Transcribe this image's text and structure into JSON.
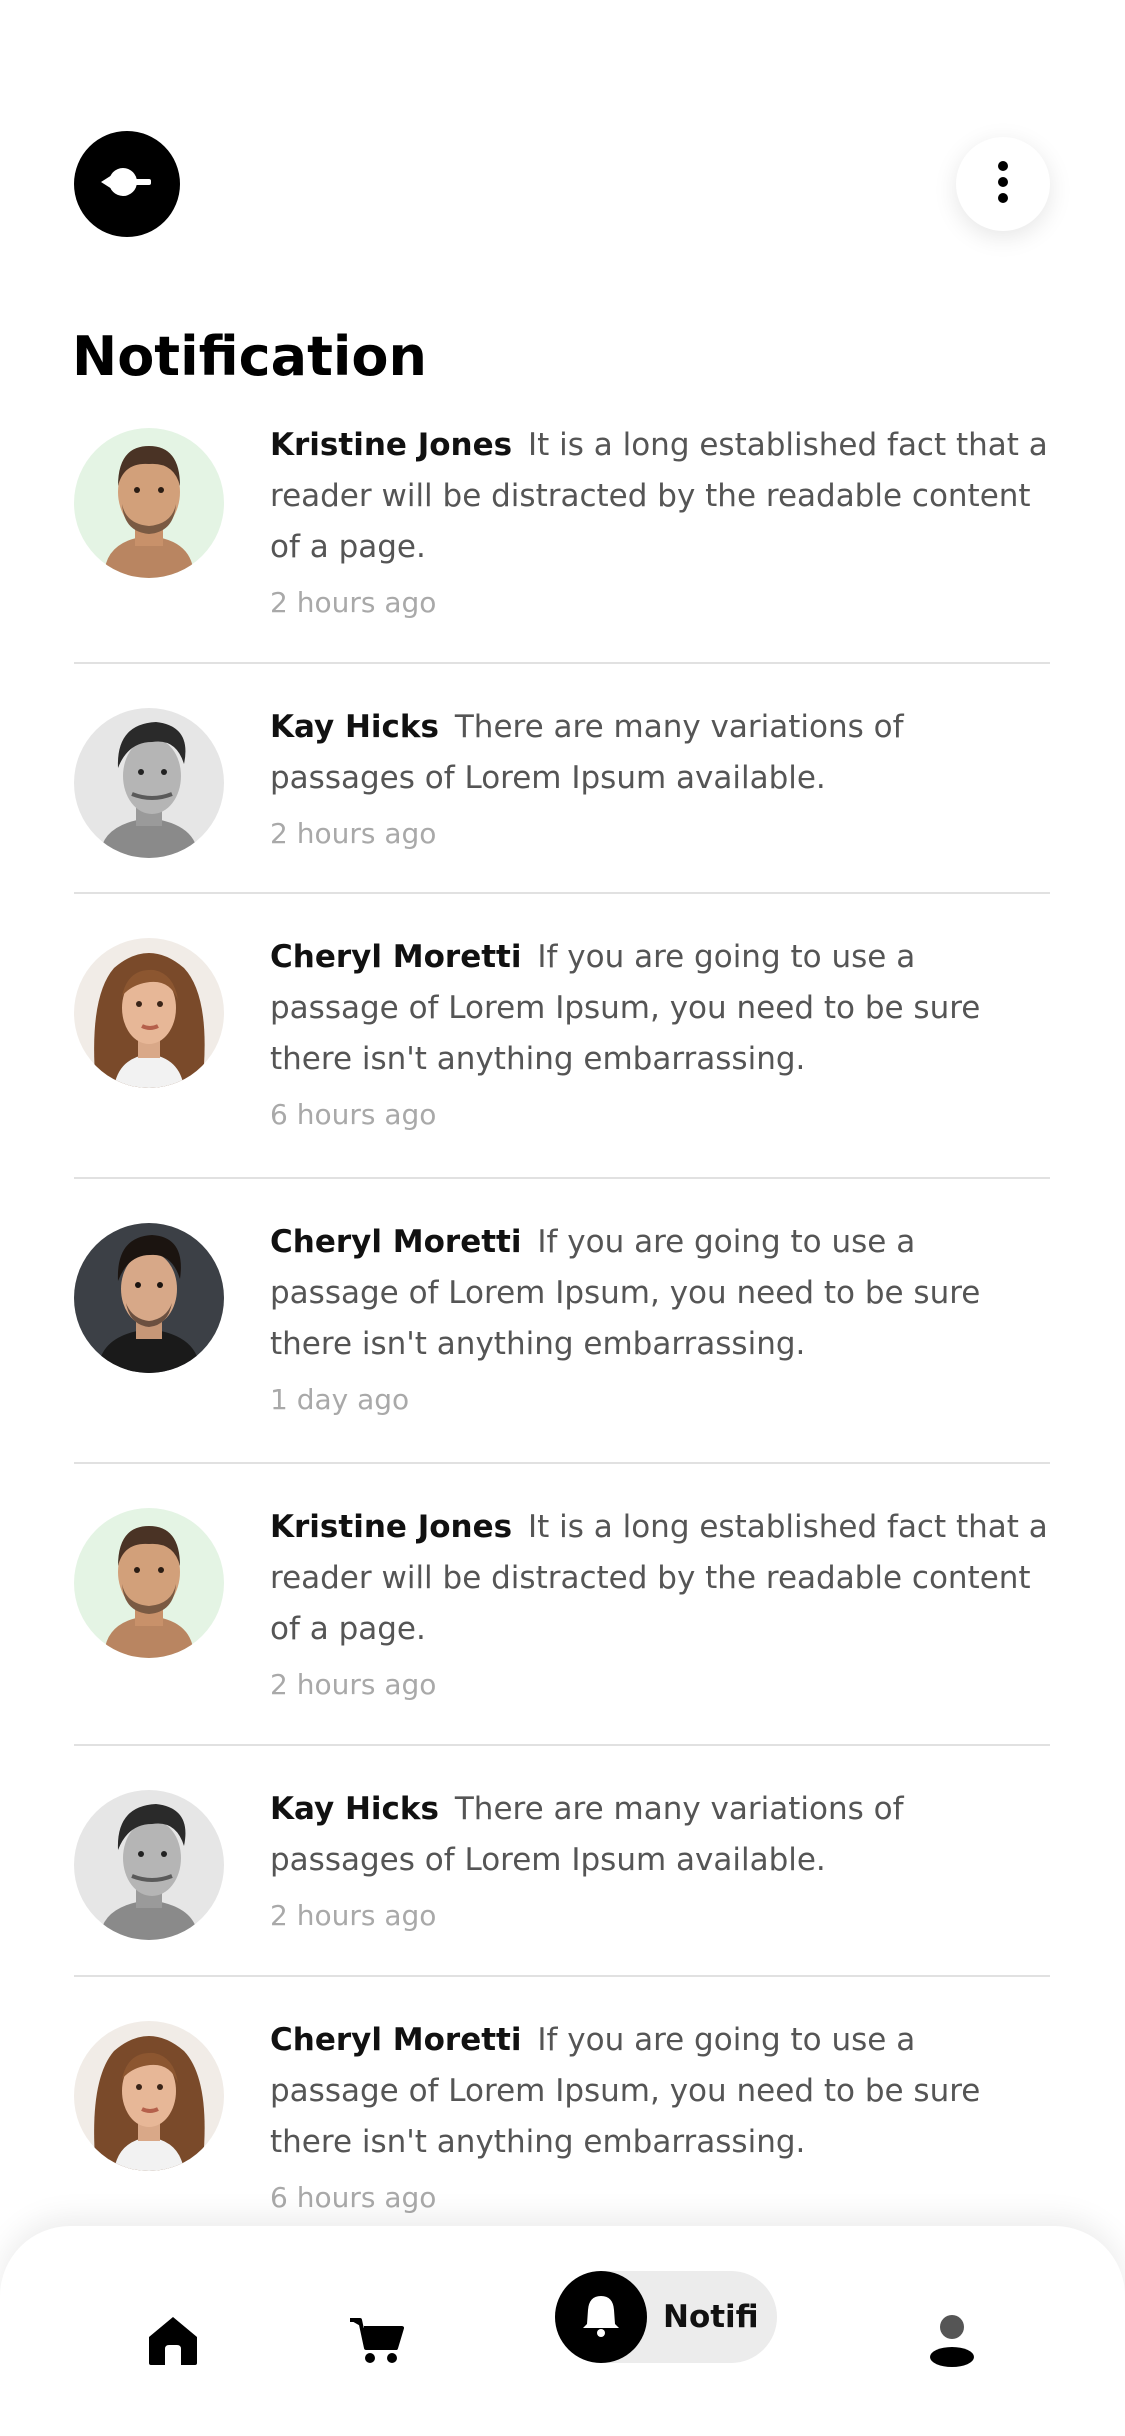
{
  "header": {
    "title": "Notification"
  },
  "notifications": [
    {
      "name": "Kristine Jones",
      "message": "It is a long established fact that a reader will be distracted by the readable content of a page.",
      "time": "2 hours ago",
      "avatar": "man-beard-green"
    },
    {
      "name": "Kay Hicks",
      "message": "There are many variations of passages of Lorem Ipsum available.",
      "time": "2 hours ago",
      "avatar": "man-bw"
    },
    {
      "name": "Cheryl Moretti",
      "message": "If you are going to use a passage of Lorem Ipsum, you need to be sure there isn't anything embarrassing.",
      "time": "6 hours ago",
      "avatar": "woman-brunette"
    },
    {
      "name": "Cheryl Moretti",
      "message": "If you are going to use a passage of Lorem Ipsum, you need to be sure there isn't anything embarrassing.",
      "time": "1 day ago",
      "avatar": "man-dark"
    },
    {
      "name": "Kristine Jones",
      "message": "It is a long established fact that a reader will be distracted by the readable content of a page.",
      "time": "2 hours ago",
      "avatar": "man-beard-green"
    },
    {
      "name": "Kay Hicks",
      "message": "There are many variations of passages of Lorem Ipsum available.",
      "time": "2 hours ago",
      "avatar": "man-bw"
    },
    {
      "name": "Cheryl Moretti",
      "message": "If you are going to use a passage of Lorem Ipsum, you need to be sure there isn't anything embarrassing.",
      "time": "6 hours ago",
      "avatar": "woman-brunette"
    }
  ],
  "bottom_nav": {
    "active_label": "Notifi",
    "items": [
      "home-icon",
      "cart-icon",
      "bell-icon",
      "profile-icon"
    ]
  },
  "colors": {
    "accent": "#000000",
    "muted_text": "#555555",
    "time_text": "#a9a9a9",
    "divider": "#e1e1e1",
    "pill_bg": "#ececec"
  }
}
